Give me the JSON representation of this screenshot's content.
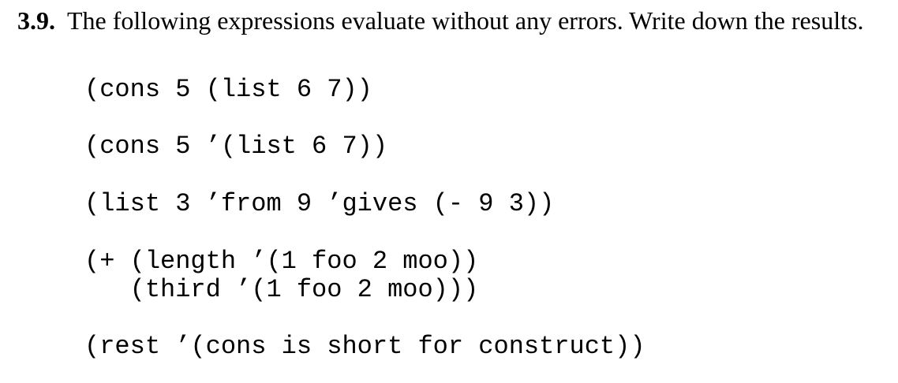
{
  "exercise": {
    "number": "3.9.",
    "prompt": "The following expressions evaluate without any errors.  Write down the results."
  },
  "expressions": [
    "(cons 5 (list 6 7))",
    "(cons 5 ’(list 6 7))",
    "(list 3 ’from 9 ’gives (- 9 3))",
    "(+ (length ’(1 foo 2 moo))\n   (third ’(1 foo 2 moo)))",
    "(rest ’(cons is short for construct))"
  ]
}
